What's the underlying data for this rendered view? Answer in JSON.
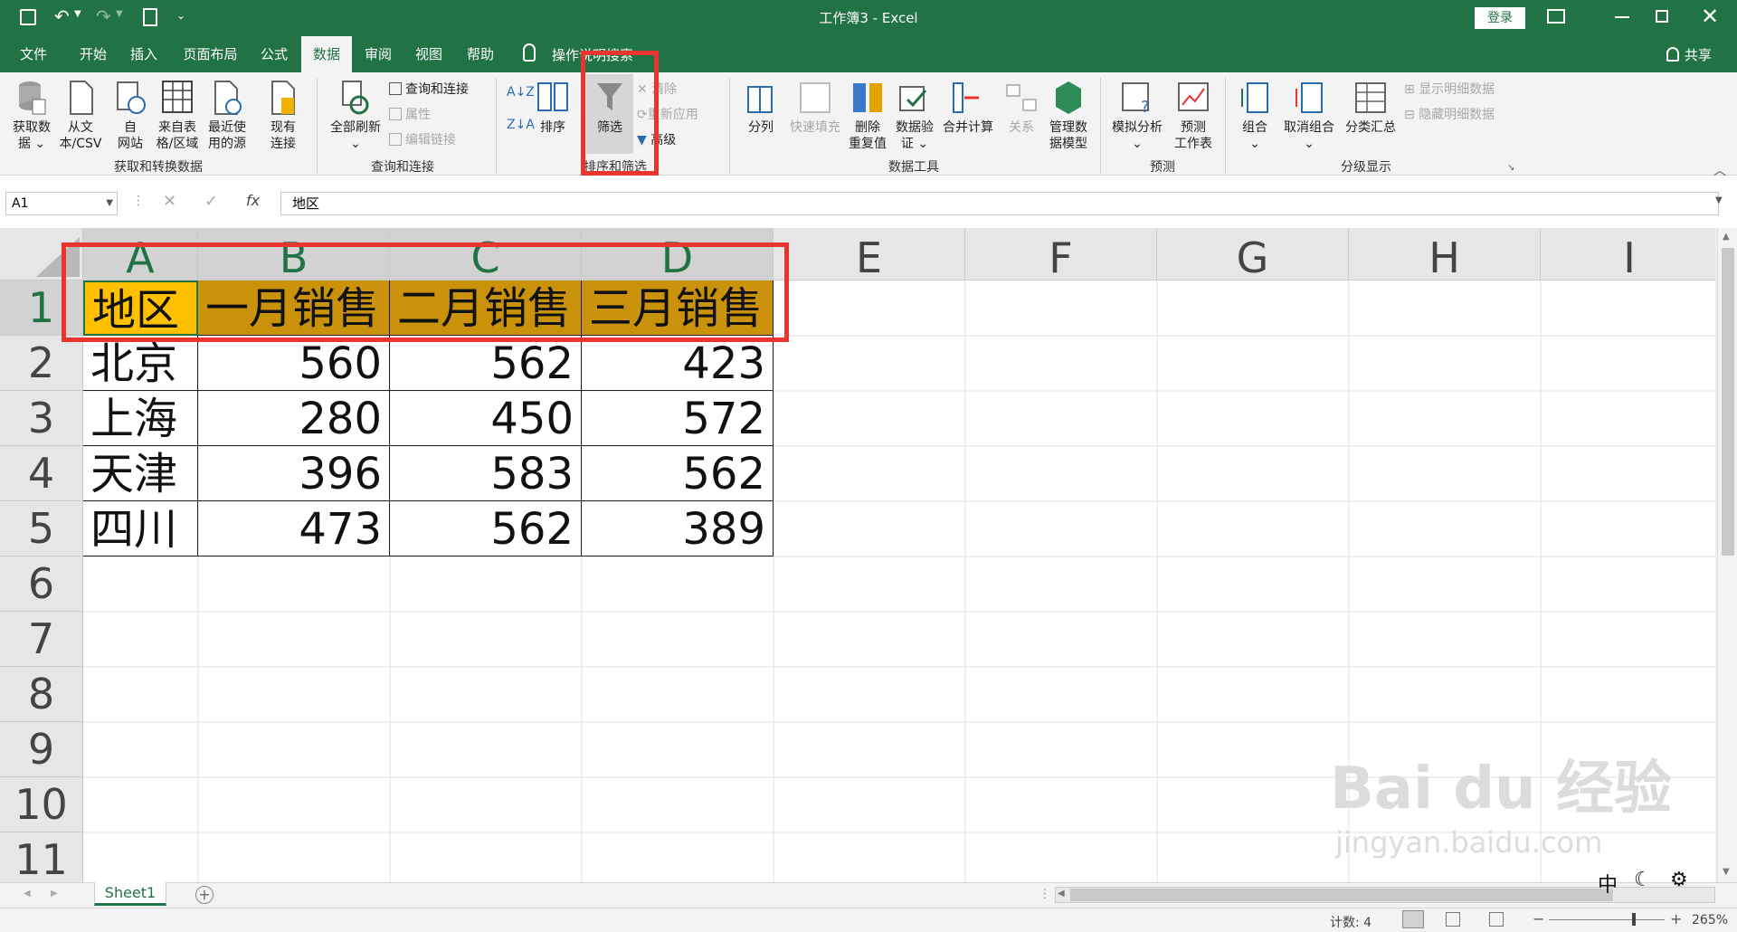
{
  "app": {
    "title": "工作簿3 - Excel",
    "login_label": "登录",
    "share_label": "共享"
  },
  "tabs": [
    "文件",
    "开始",
    "插入",
    "页面布局",
    "公式",
    "数据",
    "审阅",
    "视图",
    "帮助"
  ],
  "active_tab": "数据",
  "tell_me": "操作说明搜索",
  "ribbon": {
    "get_transform": {
      "group_label": "获取和转换数据",
      "buttons": [
        "获取数\n据 ⌄",
        "从文\n本/CSV",
        "自\n网站",
        "来自表\n格/区域",
        "最近使\n用的源",
        "现有\n连接"
      ]
    },
    "queries": {
      "group_label": "查询和连接",
      "refresh_all": "全部刷新\n⌄",
      "items": [
        "查询和连接",
        "属性",
        "编辑链接"
      ]
    },
    "sort_filter": {
      "group_label": "排序和筛选",
      "sort_label": "排序",
      "filter_label": "筛选",
      "items": [
        "清除",
        "重新应用",
        "高级"
      ]
    },
    "data_tools": {
      "group_label": "数据工具",
      "buttons": [
        "分列",
        "快速填充",
        "删除\n重复值",
        "数据验\n证 ⌄",
        "合并计算",
        "关系",
        "管理数\n据模型"
      ]
    },
    "forecast": {
      "group_label": "预测",
      "buttons": [
        "模拟分析\n⌄",
        "预测\n工作表"
      ]
    },
    "outline": {
      "group_label": "分级显示",
      "buttons": [
        "组合\n⌄",
        "取消组合\n⌄",
        "分类汇总"
      ],
      "items": [
        "显示明细数据",
        "隐藏明细数据"
      ]
    }
  },
  "formula_bar": {
    "name_box": "A1",
    "fx": "fx",
    "content": "地区"
  },
  "columns": [
    "A",
    "B",
    "C",
    "D",
    "E",
    "F",
    "G",
    "H",
    "I"
  ],
  "rows": [
    "1",
    "2",
    "3",
    "4",
    "5",
    "6",
    "7",
    "8",
    "9",
    "10",
    "11"
  ],
  "table": {
    "header": [
      "地区",
      "一月销售",
      "二月销售",
      "三月销售"
    ],
    "rows": [
      [
        "北京",
        "560",
        "562",
        "423"
      ],
      [
        "上海",
        "280",
        "450",
        "572"
      ],
      [
        "天津",
        "396",
        "583",
        "562"
      ],
      [
        "四川",
        "473",
        "562",
        "389"
      ]
    ]
  },
  "sheet_tab": "Sheet1",
  "status": {
    "count": "计数: 4",
    "zoom": "265%"
  },
  "colors": {
    "excel_green": "#217346",
    "header_fill_a": "#ffc000",
    "header_fill_other": "#c9920a",
    "annotation_red": "#e8352f"
  },
  "watermark": {
    "brand": "Bai du 经验",
    "url": "jingyan.baidu.com"
  }
}
